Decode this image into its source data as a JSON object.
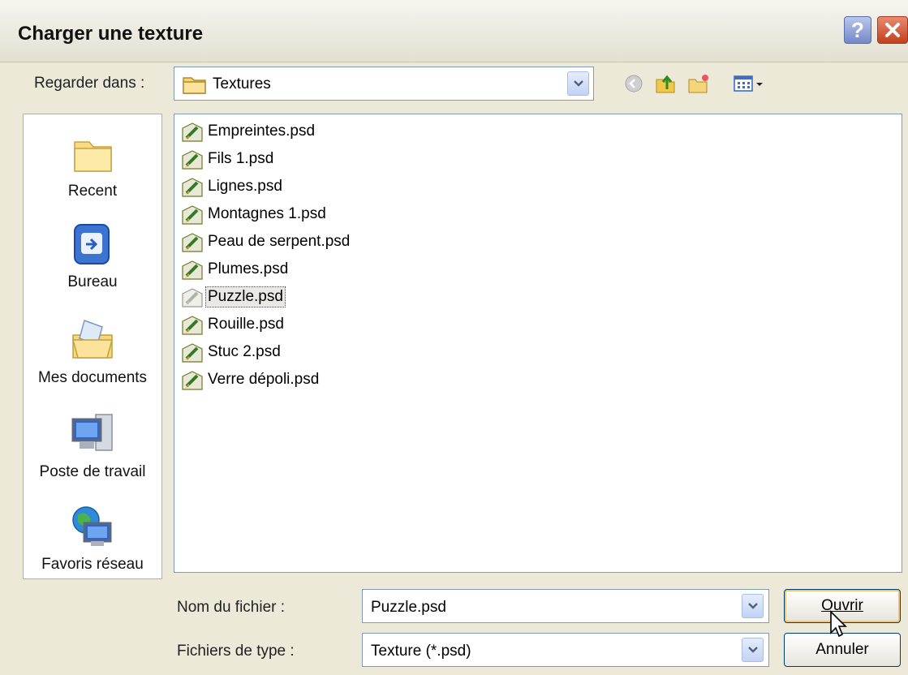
{
  "window": {
    "title": "Charger une texture",
    "help_label": "?",
    "close_icon": "close-icon"
  },
  "lookin": {
    "label": "Regarder dans :",
    "value": "Textures",
    "folder_icon": "folder-icon"
  },
  "toolbar": {
    "icons": [
      "back-icon",
      "up-folder-icon",
      "new-folder-icon",
      "view-menu-icon"
    ]
  },
  "places": [
    {
      "label": "Recent",
      "icon": "recent-folder-icon"
    },
    {
      "label": "Bureau",
      "icon": "desktop-icon"
    },
    {
      "label": "Mes documents",
      "icon": "my-documents-icon"
    },
    {
      "label": "Poste de travail",
      "icon": "my-computer-icon"
    },
    {
      "label": "Favoris réseau",
      "icon": "network-places-icon"
    }
  ],
  "files": [
    "Empreintes.psd",
    "Fils 1.psd",
    "Lignes.psd",
    "Montagnes 1.psd",
    "Peau de serpent.psd",
    "Plumes.psd",
    "Puzzle.psd",
    "Rouille.psd",
    "Stuc 2.psd",
    "Verre dépoli.psd"
  ],
  "selected_file": "Puzzle.psd",
  "filename": {
    "label": "Nom du fichier :",
    "value": "Puzzle.psd"
  },
  "filetype": {
    "label": "Fichiers de type :",
    "value": "Texture (*.psd)"
  },
  "buttons": {
    "open": "Ouvrir",
    "cancel": "Annuler"
  },
  "colors": {
    "window_bg": "#ece9d8",
    "field_border": "#7f9db9",
    "default_button_glow": "#f4c46a"
  }
}
